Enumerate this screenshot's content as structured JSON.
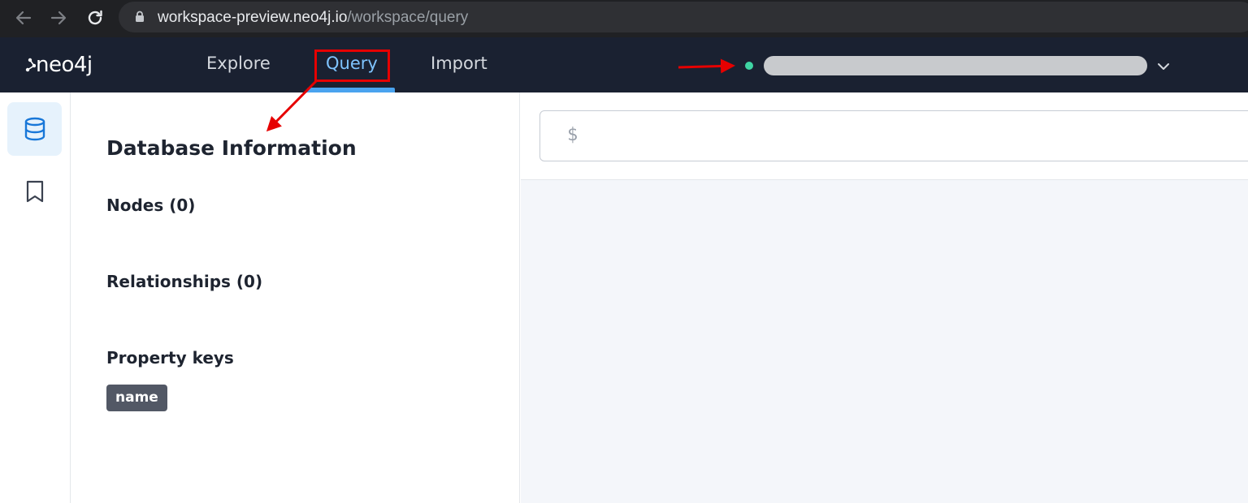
{
  "browser": {
    "url_host": "workspace-preview.neo4j.io",
    "url_path": "/workspace/query",
    "icons": [
      "back-arrow-icon",
      "forward-arrow-icon",
      "reload-icon",
      "lock-icon"
    ]
  },
  "header": {
    "logo": "neo4j",
    "nav": [
      {
        "label": "Explore",
        "active": false
      },
      {
        "label": "Query",
        "active": true
      },
      {
        "label": "Import",
        "active": false
      }
    ],
    "connection_status_color": "#3fd4a3",
    "accent_color": "#4aa3ef"
  },
  "rail": {
    "items": [
      {
        "icon": "database-icon",
        "active": true
      },
      {
        "icon": "bookmark-icon",
        "active": false
      }
    ]
  },
  "info_panel": {
    "title": "Database Information",
    "nodes_label": "Nodes (0)",
    "relationships_label": "Relationships (0)",
    "property_keys_label": "Property keys",
    "property_keys": [
      "name"
    ]
  },
  "query": {
    "prompt": "$"
  },
  "annotations": {
    "color": "#e60000"
  }
}
